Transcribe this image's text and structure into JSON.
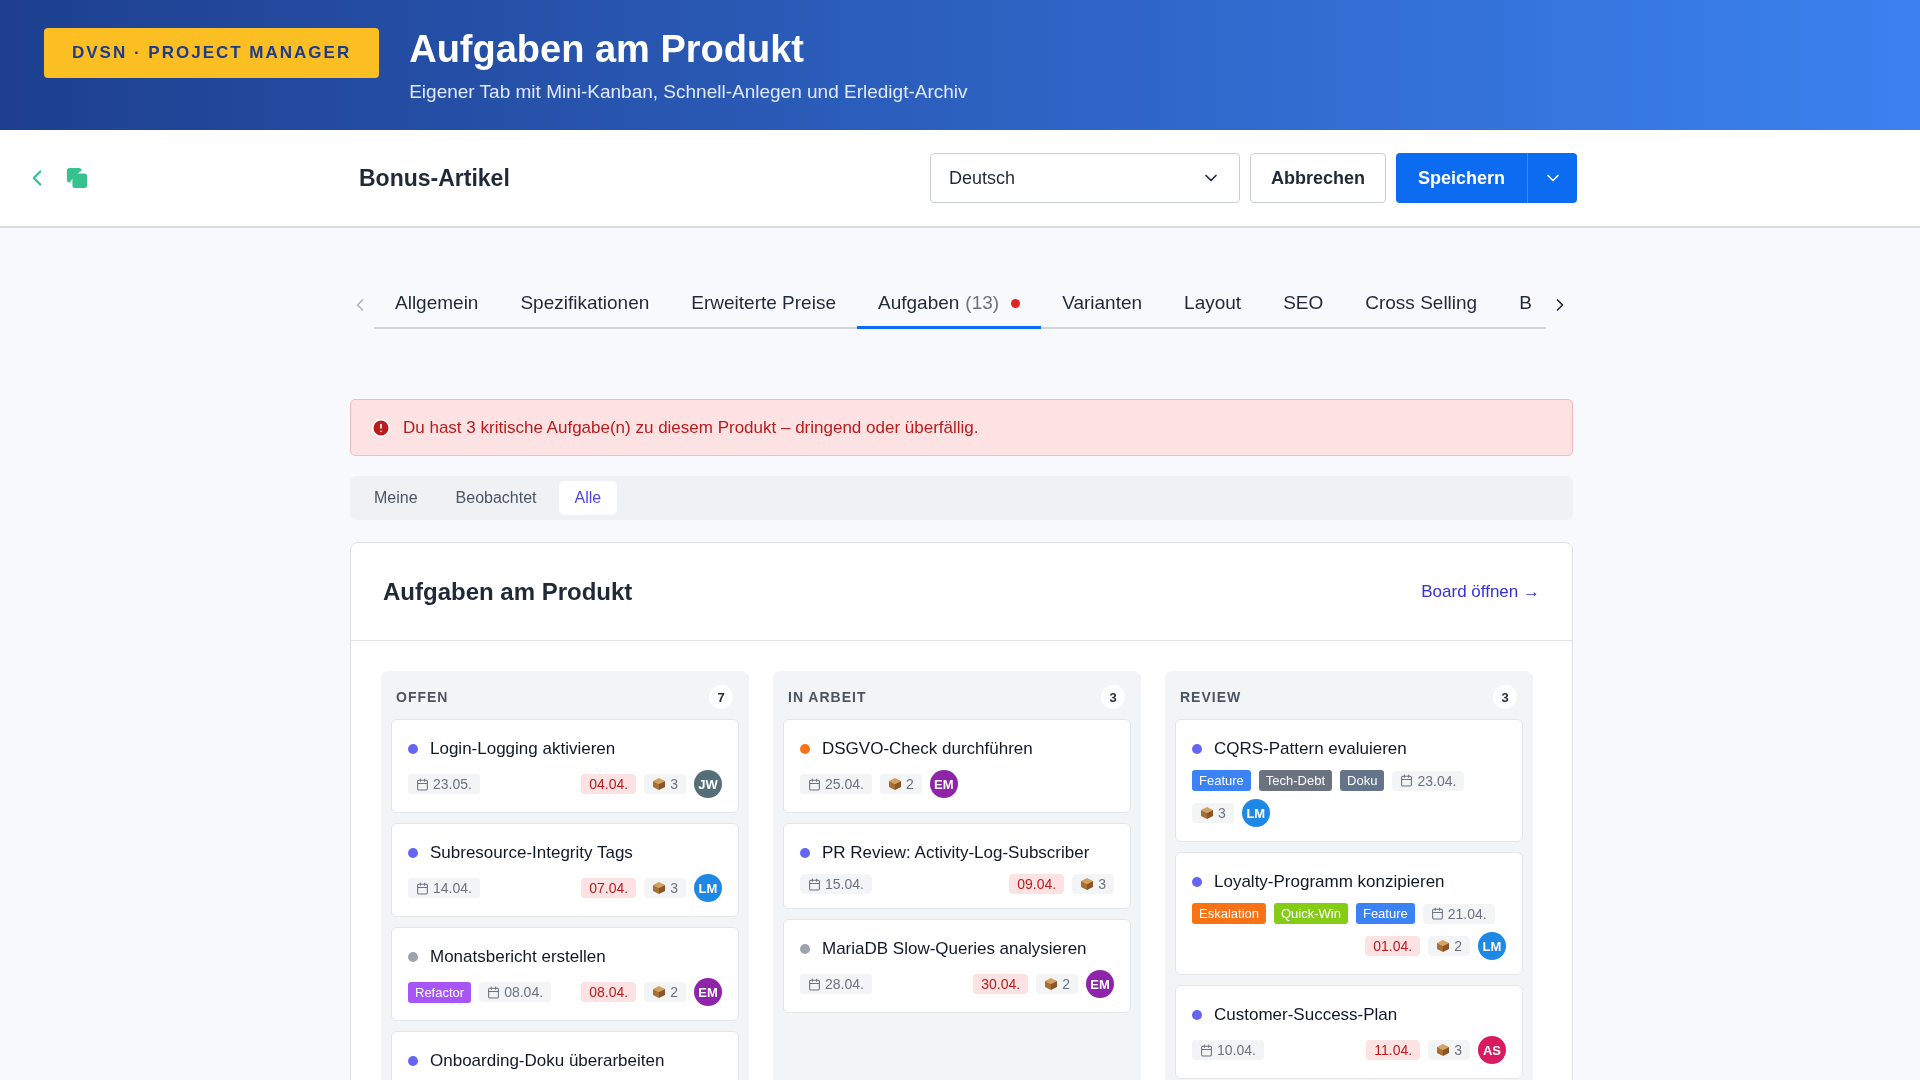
{
  "header": {
    "badge": "DVSN · PROJECT MANAGER",
    "title": "Aufgaben am Produkt",
    "subtitle": "Eigener Tab mit Mini-Kanban, Schnell-Anlegen und Erledigt-Archiv"
  },
  "toolbar": {
    "product": "Bonus-Artikel",
    "language": "Deutsch",
    "cancel": "Abbrechen",
    "save": "Speichern"
  },
  "tabs": [
    {
      "label": "Allgemein",
      "selected": false
    },
    {
      "label": "Spezifikationen",
      "selected": false
    },
    {
      "label": "Erweiterte Preise",
      "selected": false
    },
    {
      "label": "Aufgaben",
      "count": "(13)",
      "alert": true,
      "selected": true
    },
    {
      "label": "Varianten",
      "selected": false
    },
    {
      "label": "Layout",
      "selected": false
    },
    {
      "label": "SEO",
      "selected": false
    },
    {
      "label": "Cross Selling",
      "selected": false
    },
    {
      "label": "B",
      "selected": false
    }
  ],
  "alert": "Du hast 3 kritische Aufgabe(n) zu diesem Produkt – dringend oder überfällig.",
  "filters": [
    {
      "label": "Meine",
      "selected": false
    },
    {
      "label": "Beobachtet",
      "selected": false
    },
    {
      "label": "Alle",
      "selected": true
    }
  ],
  "board": {
    "title": "Aufgaben am Produkt",
    "link": "Board öffnen →",
    "columns": [
      {
        "title": "OFFEN",
        "count": "7",
        "tasks": [
          {
            "title": "Login-Logging aktivieren",
            "color": "#6366f1",
            "date": "23.05.",
            "due": "04.04.",
            "items": "3",
            "assignee": {
              "initials": "JW",
              "color": "#546e7a"
            }
          },
          {
            "title": "Subresource-Integrity Tags",
            "color": "#6366f1",
            "date": "14.04.",
            "due": "07.04.",
            "items": "3",
            "assignee": {
              "initials": "LM",
              "color": "#1e88e5"
            }
          },
          {
            "title": "Monatsbericht erstellen",
            "color": "#9ca3af",
            "tags": [
              {
                "label": "Refactor",
                "color": "#a855f7"
              }
            ],
            "date": "08.04.",
            "due": "08.04.",
            "items": "2",
            "assignee": {
              "initials": "EM",
              "color": "#8e24aa"
            }
          },
          {
            "title": "Onboarding-Doku überarbeiten",
            "color": "#6366f1"
          }
        ]
      },
      {
        "title": "IN ARBEIT",
        "count": "3",
        "tasks": [
          {
            "title": "DSGVO-Check durchführen",
            "color": "#f97316",
            "date": "25.04.",
            "items": "2",
            "assignee": {
              "initials": "EM",
              "color": "#8e24aa"
            }
          },
          {
            "title": "PR Review: Activity-Log-Subscriber",
            "color": "#6366f1",
            "date": "15.04.",
            "due": "09.04.",
            "items": "3"
          },
          {
            "title": "MariaDB Slow-Queries analysieren",
            "color": "#9ca3af",
            "date": "28.04.",
            "due": "30.04.",
            "items": "2",
            "assignee": {
              "initials": "EM",
              "color": "#8e24aa"
            }
          }
        ]
      },
      {
        "title": "REVIEW",
        "count": "3",
        "tasks": [
          {
            "title": "CQRS-Pattern evaluieren",
            "color": "#6366f1",
            "tags": [
              {
                "label": "Feature",
                "color": "#3b82f6"
              },
              {
                "label": "Tech-Debt",
                "color": "#6b7280"
              },
              {
                "label": "Doku",
                "color": "#64748b"
              }
            ],
            "date": "23.04.",
            "items": "3",
            "assignee": {
              "initials": "LM",
              "color": "#1e88e5"
            }
          },
          {
            "title": "Loyalty-Programm konzipieren",
            "color": "#6366f1",
            "tags": [
              {
                "label": "Eskalation",
                "color": "#f97316"
              },
              {
                "label": "Quick-Win",
                "color": "#84cc16"
              },
              {
                "label": "Feature",
                "color": "#3b82f6"
              }
            ],
            "date": "21.04.",
            "due": "01.04.",
            "items": "2",
            "assignee": {
              "initials": "LM",
              "color": "#1e88e5"
            }
          },
          {
            "title": "Customer-Success-Plan",
            "color": "#6366f1",
            "date": "10.04.",
            "due": "11.04.",
            "items": "3",
            "assignee": {
              "initials": "AS",
              "color": "#d81b60"
            }
          }
        ]
      }
    ]
  }
}
